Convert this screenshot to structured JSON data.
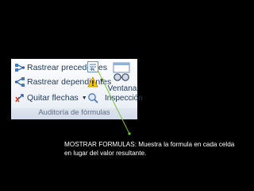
{
  "ribbon": {
    "commands": [
      {
        "label": "Rastrear precedentes",
        "icon": "trace-precedents-icon"
      },
      {
        "label": "Rastrear dependientes",
        "icon": "trace-dependents-icon"
      },
      {
        "label": "Quitar flechas",
        "icon": "remove-arrows-icon"
      }
    ],
    "side_icons": [
      "show-formulas-icon",
      "error-checking-icon",
      "evaluate-formula-icon"
    ],
    "watch_window": {
      "line1": "Ventana",
      "line2": "Inspección",
      "icon": "watch-window-icon"
    },
    "group_label": "Auditoría de fórmulas"
  },
  "caption": "MOSTRAR FORMULAS: Muestra la formula en cada celda en lugar del valor resultante.",
  "colors": {
    "pointer_line": "#7fbf3f",
    "ribbon_text": "#1e395b"
  }
}
